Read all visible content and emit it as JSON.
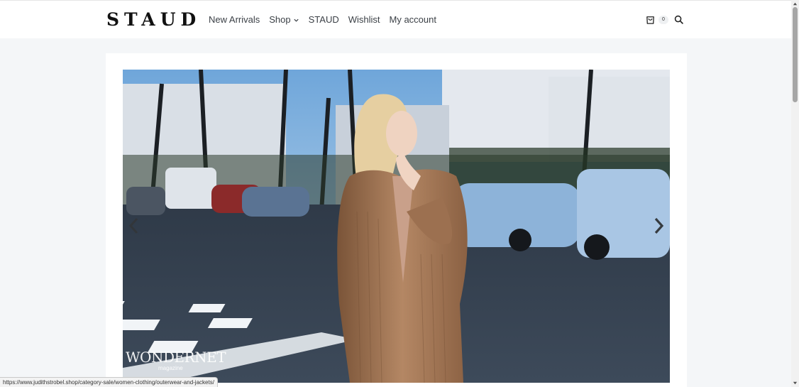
{
  "header": {
    "logo": "STAUD",
    "nav": [
      {
        "label": "New Arrivals",
        "has_dropdown": false
      },
      {
        "label": "Shop",
        "has_dropdown": true
      },
      {
        "label": "STAUD",
        "has_dropdown": false
      },
      {
        "label": "Wishlist",
        "has_dropdown": false
      },
      {
        "label": "My account",
        "has_dropdown": false
      }
    ],
    "cart_count": "0",
    "cart_icon": "shopping-bag-icon",
    "search_icon": "search-icon"
  },
  "slider": {
    "prev_icon": "chevron-left-icon",
    "next_icon": "chevron-right-icon",
    "watermark": {
      "main": "WONDERNET",
      "sub": "magazine"
    }
  },
  "status_bar": {
    "url": "https://www.judithstrobel.shop/category-sale/women-clothing/outerwear-and-jackets/"
  },
  "colors": {
    "page_bg": "#f4f6f8",
    "header_bg": "#ffffff",
    "text": "#3a3f45",
    "logo": "#111111"
  }
}
